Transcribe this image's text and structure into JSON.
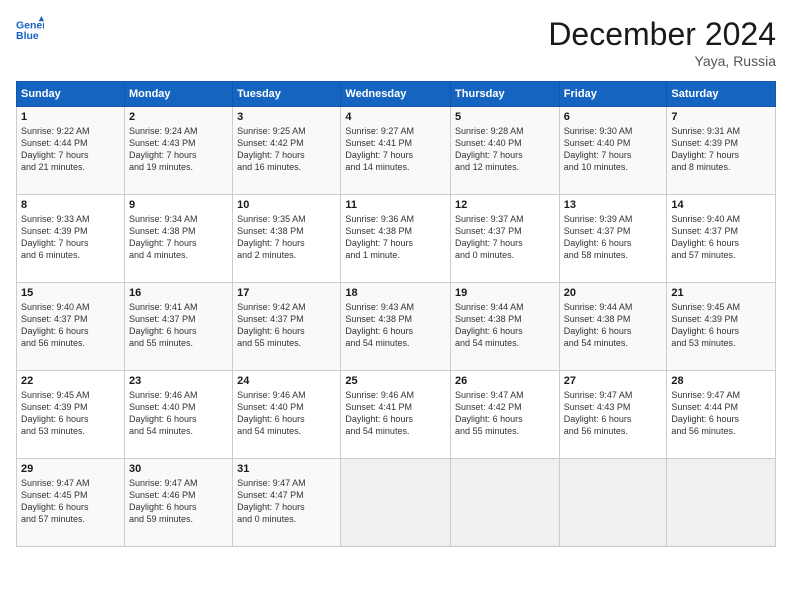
{
  "header": {
    "logo_line1": "General",
    "logo_line2": "Blue",
    "month": "December 2024",
    "location": "Yaya, Russia"
  },
  "days_of_week": [
    "Sunday",
    "Monday",
    "Tuesday",
    "Wednesday",
    "Thursday",
    "Friday",
    "Saturday"
  ],
  "weeks": [
    [
      {
        "day": "1",
        "info": "Sunrise: 9:22 AM\nSunset: 4:44 PM\nDaylight: 7 hours\nand 21 minutes."
      },
      {
        "day": "2",
        "info": "Sunrise: 9:24 AM\nSunset: 4:43 PM\nDaylight: 7 hours\nand 19 minutes."
      },
      {
        "day": "3",
        "info": "Sunrise: 9:25 AM\nSunset: 4:42 PM\nDaylight: 7 hours\nand 16 minutes."
      },
      {
        "day": "4",
        "info": "Sunrise: 9:27 AM\nSunset: 4:41 PM\nDaylight: 7 hours\nand 14 minutes."
      },
      {
        "day": "5",
        "info": "Sunrise: 9:28 AM\nSunset: 4:40 PM\nDaylight: 7 hours\nand 12 minutes."
      },
      {
        "day": "6",
        "info": "Sunrise: 9:30 AM\nSunset: 4:40 PM\nDaylight: 7 hours\nand 10 minutes."
      },
      {
        "day": "7",
        "info": "Sunrise: 9:31 AM\nSunset: 4:39 PM\nDaylight: 7 hours\nand 8 minutes."
      }
    ],
    [
      {
        "day": "8",
        "info": "Sunrise: 9:33 AM\nSunset: 4:39 PM\nDaylight: 7 hours\nand 6 minutes."
      },
      {
        "day": "9",
        "info": "Sunrise: 9:34 AM\nSunset: 4:38 PM\nDaylight: 7 hours\nand 4 minutes."
      },
      {
        "day": "10",
        "info": "Sunrise: 9:35 AM\nSunset: 4:38 PM\nDaylight: 7 hours\nand 2 minutes."
      },
      {
        "day": "11",
        "info": "Sunrise: 9:36 AM\nSunset: 4:38 PM\nDaylight: 7 hours\nand 1 minute."
      },
      {
        "day": "12",
        "info": "Sunrise: 9:37 AM\nSunset: 4:37 PM\nDaylight: 7 hours\nand 0 minutes."
      },
      {
        "day": "13",
        "info": "Sunrise: 9:39 AM\nSunset: 4:37 PM\nDaylight: 6 hours\nand 58 minutes."
      },
      {
        "day": "14",
        "info": "Sunrise: 9:40 AM\nSunset: 4:37 PM\nDaylight: 6 hours\nand 57 minutes."
      }
    ],
    [
      {
        "day": "15",
        "info": "Sunrise: 9:40 AM\nSunset: 4:37 PM\nDaylight: 6 hours\nand 56 minutes."
      },
      {
        "day": "16",
        "info": "Sunrise: 9:41 AM\nSunset: 4:37 PM\nDaylight: 6 hours\nand 55 minutes."
      },
      {
        "day": "17",
        "info": "Sunrise: 9:42 AM\nSunset: 4:37 PM\nDaylight: 6 hours\nand 55 minutes."
      },
      {
        "day": "18",
        "info": "Sunrise: 9:43 AM\nSunset: 4:38 PM\nDaylight: 6 hours\nand 54 minutes."
      },
      {
        "day": "19",
        "info": "Sunrise: 9:44 AM\nSunset: 4:38 PM\nDaylight: 6 hours\nand 54 minutes."
      },
      {
        "day": "20",
        "info": "Sunrise: 9:44 AM\nSunset: 4:38 PM\nDaylight: 6 hours\nand 54 minutes."
      },
      {
        "day": "21",
        "info": "Sunrise: 9:45 AM\nSunset: 4:39 PM\nDaylight: 6 hours\nand 53 minutes."
      }
    ],
    [
      {
        "day": "22",
        "info": "Sunrise: 9:45 AM\nSunset: 4:39 PM\nDaylight: 6 hours\nand 53 minutes."
      },
      {
        "day": "23",
        "info": "Sunrise: 9:46 AM\nSunset: 4:40 PM\nDaylight: 6 hours\nand 54 minutes."
      },
      {
        "day": "24",
        "info": "Sunrise: 9:46 AM\nSunset: 4:40 PM\nDaylight: 6 hours\nand 54 minutes."
      },
      {
        "day": "25",
        "info": "Sunrise: 9:46 AM\nSunset: 4:41 PM\nDaylight: 6 hours\nand 54 minutes."
      },
      {
        "day": "26",
        "info": "Sunrise: 9:47 AM\nSunset: 4:42 PM\nDaylight: 6 hours\nand 55 minutes."
      },
      {
        "day": "27",
        "info": "Sunrise: 9:47 AM\nSunset: 4:43 PM\nDaylight: 6 hours\nand 56 minutes."
      },
      {
        "day": "28",
        "info": "Sunrise: 9:47 AM\nSunset: 4:44 PM\nDaylight: 6 hours\nand 56 minutes."
      }
    ],
    [
      {
        "day": "29",
        "info": "Sunrise: 9:47 AM\nSunset: 4:45 PM\nDaylight: 6 hours\nand 57 minutes."
      },
      {
        "day": "30",
        "info": "Sunrise: 9:47 AM\nSunset: 4:46 PM\nDaylight: 6 hours\nand 59 minutes."
      },
      {
        "day": "31",
        "info": "Sunrise: 9:47 AM\nSunset: 4:47 PM\nDaylight: 7 hours\nand 0 minutes."
      },
      {
        "day": "",
        "info": ""
      },
      {
        "day": "",
        "info": ""
      },
      {
        "day": "",
        "info": ""
      },
      {
        "day": "",
        "info": ""
      }
    ]
  ]
}
